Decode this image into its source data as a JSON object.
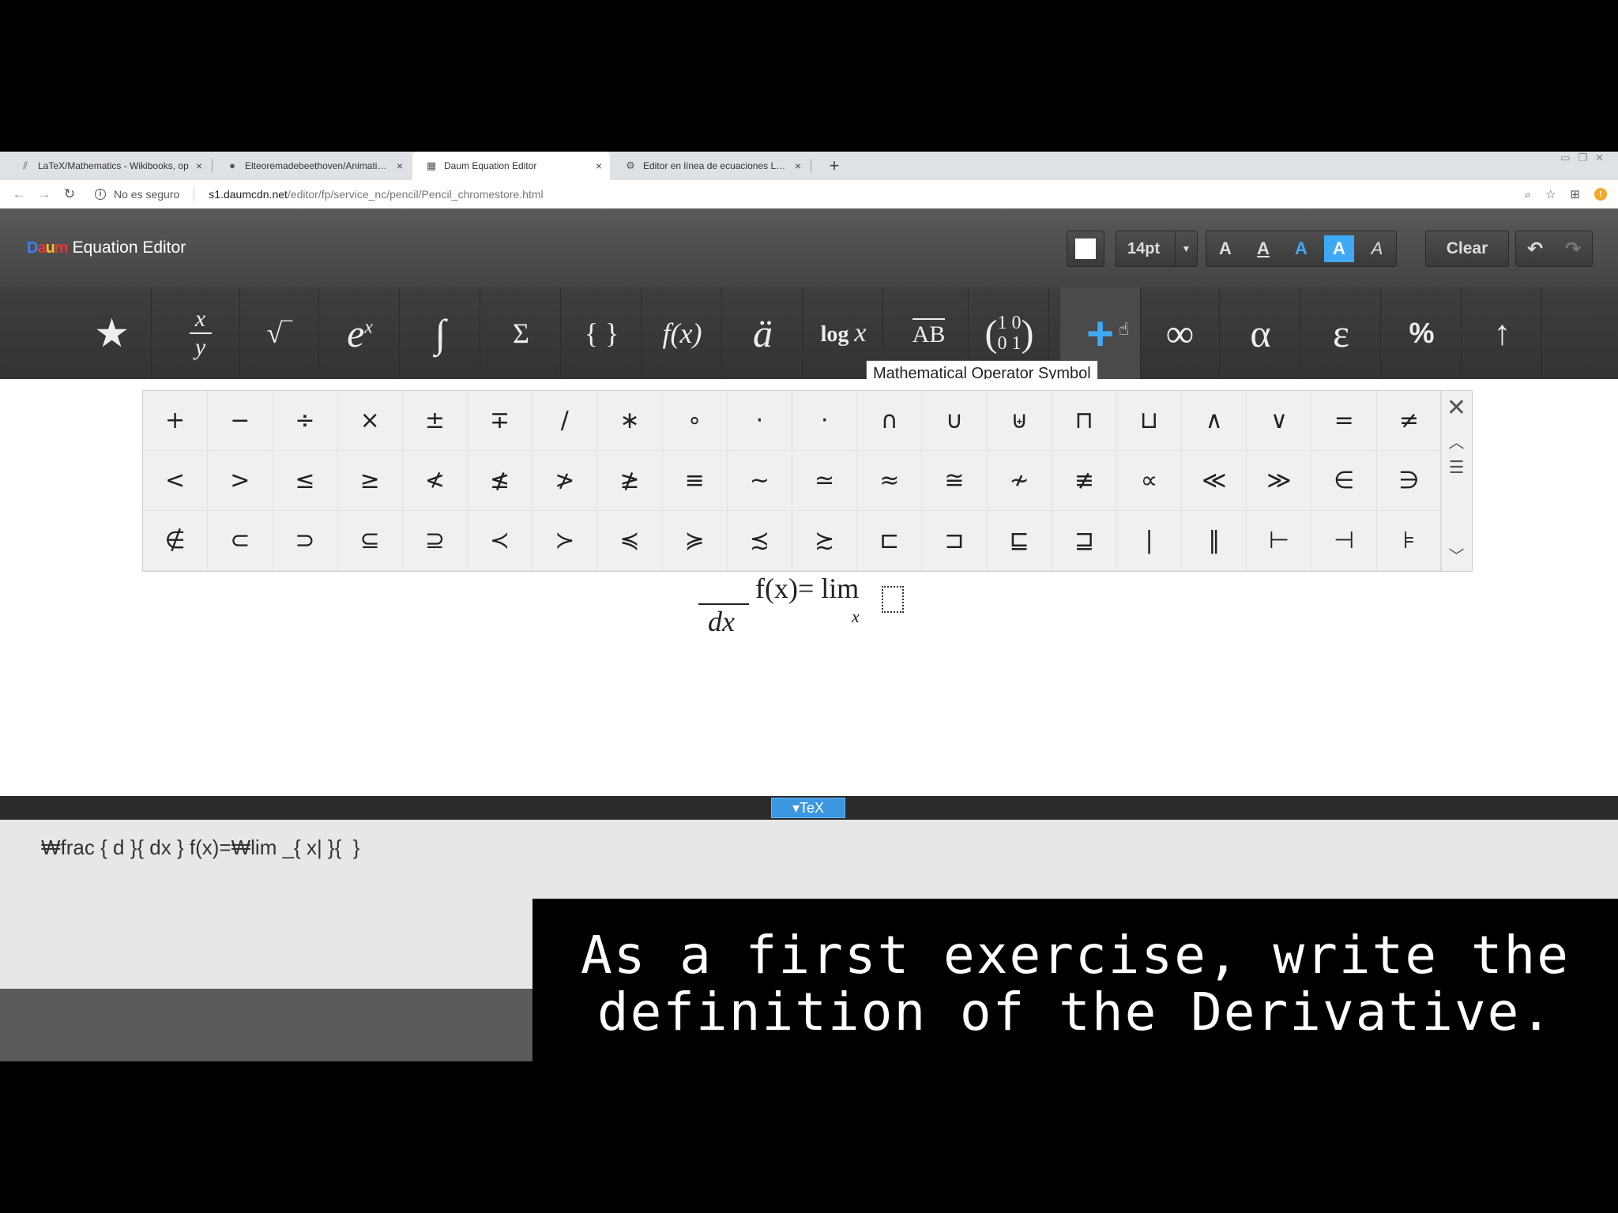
{
  "browser": {
    "tabs": [
      {
        "title": "LaTeX/Mathematics - Wikibooks, op",
        "icon": "wikibooks-icon",
        "active": false
      },
      {
        "title": "Elteoremadebeethoven/AnimationsW",
        "icon": "github-icon",
        "active": false
      },
      {
        "title": "Daum Equation Editor",
        "icon": "daum-icon",
        "active": true
      },
      {
        "title": "Editor en línea de ecuaciones LateX",
        "icon": "gear-icon",
        "active": false
      }
    ],
    "security_label": "No es seguro",
    "url_host": "s1.daumcdn.net",
    "url_path": "/editor/fp/service_nc/pencil/Pencil_chromestore.html"
  },
  "editor": {
    "logo_text": "Equation Editor",
    "font_size": "14pt",
    "clear_label": "Clear",
    "style_letters": [
      "A",
      "A",
      "A",
      "A",
      "A"
    ],
    "accent_color": "#3fa9f5"
  },
  "toolbar": {
    "tooltip": "Mathematical Operator Symbol",
    "categories": {
      "favorites": "★",
      "frac_top": "x",
      "frac_bottom": "y",
      "sqrt": "√‾",
      "exp_base": "e",
      "exp_sup": "x",
      "integral": "∫",
      "sum": "Σ",
      "brackets": "{ }",
      "function": "f(x)",
      "accent": "ä",
      "log_word": "log",
      "log_var": "x",
      "vector": "AB",
      "matrix_row1": "1 0",
      "matrix_row2": "0 1",
      "operator": "+",
      "infinity": "∞",
      "alpha": "α",
      "epsilon": "ε",
      "percent": "%",
      "arrow": "↑"
    }
  },
  "palette": {
    "symbols": [
      "+",
      "−",
      "÷",
      "×",
      "±",
      "∓",
      "/",
      "∗",
      "∘",
      "·",
      "⋅",
      "∩",
      "∪",
      "⊎",
      "⊓",
      "⊔",
      "∧",
      "∨",
      "=",
      "≠",
      "<",
      ">",
      "≤",
      "≥",
      "≮",
      "≰",
      "≯",
      "≱",
      "≡",
      "∼",
      "≃",
      "≈",
      "≅",
      "≁",
      "≢",
      "∝",
      "≪",
      "≫",
      "∈",
      "∋",
      "∉",
      "⊂",
      "⊃",
      "⊆",
      "⊇",
      "≺",
      "≻",
      "≼",
      "≽",
      "≾",
      "≿",
      "⊏",
      "⊐",
      "⊑",
      "⊒",
      "|",
      "‖",
      "⊢",
      "⊣",
      "⊧"
    ]
  },
  "equation": {
    "denominator": "dx",
    "main": "f(x)= lim",
    "subscript": "x"
  },
  "tex": {
    "tab_label": "▾TeX",
    "code": "₩frac { d }{ dx } f(x)=₩lim _{ x| }{  }"
  },
  "subtitle": {
    "line1": "As a first exercise, write the",
    "line2": "definition of the Derivative."
  }
}
